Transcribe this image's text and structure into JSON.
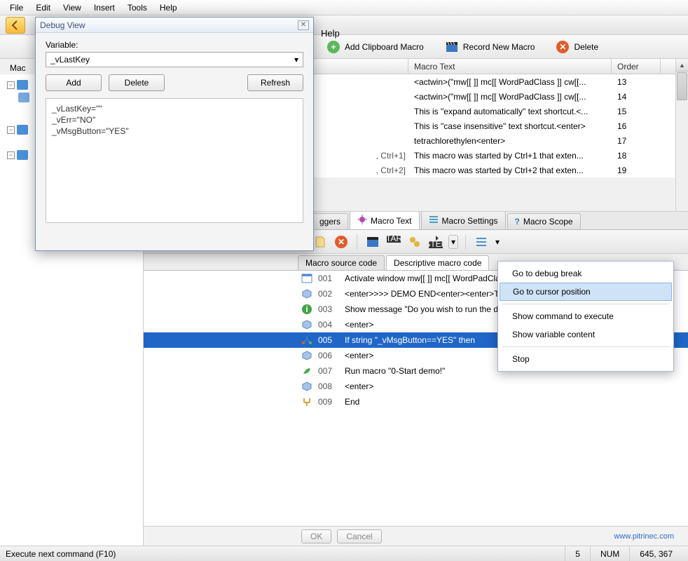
{
  "menubar": {
    "items": [
      "File",
      "Edit",
      "View",
      "Insert",
      "Tools",
      "Help"
    ]
  },
  "toolbar_help": "Help",
  "cmdbar": {
    "add_clipboard": "Add Clipboard Macro",
    "record_new": "Record New Macro",
    "delete": "Delete"
  },
  "tree_label": "Mac",
  "grid": {
    "headers": {
      "macro_text": "Macro Text",
      "order": "Order"
    },
    "frag_col": [
      ", Ctrl+1]",
      ", Ctrl+2]"
    ],
    "rows": [
      {
        "text": "<actwin>(\"mw[[ ]] mc[[ WordPadClass ]] cw[[...",
        "order": "13"
      },
      {
        "text": "<actwin>(\"mw[[ ]] mc[[ WordPadClass ]] cw[[...",
        "order": "14"
      },
      {
        "text": "This is \"expand automatically\" text shortcut.<...",
        "order": "15"
      },
      {
        "text": "This is \"case insensitive\" text shortcut.<enter>",
        "order": "16"
      },
      {
        "text": "tetrachlorethylen<enter>",
        "order": "17"
      },
      {
        "text": "This macro was started by Ctrl+1 that exten...",
        "order": "18"
      },
      {
        "text": "This macro was started by Ctrl+2 that exten...",
        "order": "19"
      }
    ]
  },
  "tabs": {
    "triggers_fragment": "ggers",
    "macro_text": "Macro Text",
    "macro_settings": "Macro Settings",
    "macro_scope": "Macro Scope"
  },
  "subtabs": {
    "source": "Macro source code",
    "descriptive": "Descriptive macro code"
  },
  "code": {
    "lines": [
      {
        "n": "001",
        "icon": "win",
        "t": "Activate window mw[[ ]] mc[[ WordPadClass ]] cw[[ ]] cc[[ ]]"
      },
      {
        "n": "002",
        "icon": "cube",
        "t": "<enter>>>> DEMO END<enter><enter>The program is minimized in th"
      },
      {
        "n": "003",
        "icon": "info",
        "t": "Show message \"Do you wish to run the demo again?\""
      },
      {
        "n": "004",
        "icon": "cube",
        "t": "<enter>"
      },
      {
        "n": "005",
        "icon": "branch",
        "t": "If string \"_vMsgButton==YES\" then",
        "sel": true
      },
      {
        "n": "006",
        "icon": "cube",
        "t": "    <enter>"
      },
      {
        "n": "007",
        "icon": "leaf",
        "t": "    Run macro \"0-Start demo!\""
      },
      {
        "n": "008",
        "icon": "cube",
        "t": "    <enter>"
      },
      {
        "n": "009",
        "icon": "end",
        "t": "End"
      }
    ]
  },
  "bottom": {
    "ok": "OK",
    "cancel": "Cancel",
    "link": "www.pitrinec.com"
  },
  "statusbar": {
    "hint": "Execute next command (F10)",
    "col": "5",
    "num": "NUM",
    "coord": "645, 367"
  },
  "debug": {
    "title": "Debug View",
    "var_label": "Variable:",
    "var_value": "_vLastKey",
    "add": "Add",
    "delete": "Delete",
    "refresh": "Refresh",
    "lines": [
      "_vLastKey=\"\"",
      "_vErr=\"NO\"",
      "_vMsgButton=\"YES\""
    ]
  },
  "ctx": {
    "items": [
      "Go to debug break",
      "Go to cursor position",
      "Show command to execute",
      "Show variable content",
      "Stop"
    ],
    "highlight_index": 1
  }
}
